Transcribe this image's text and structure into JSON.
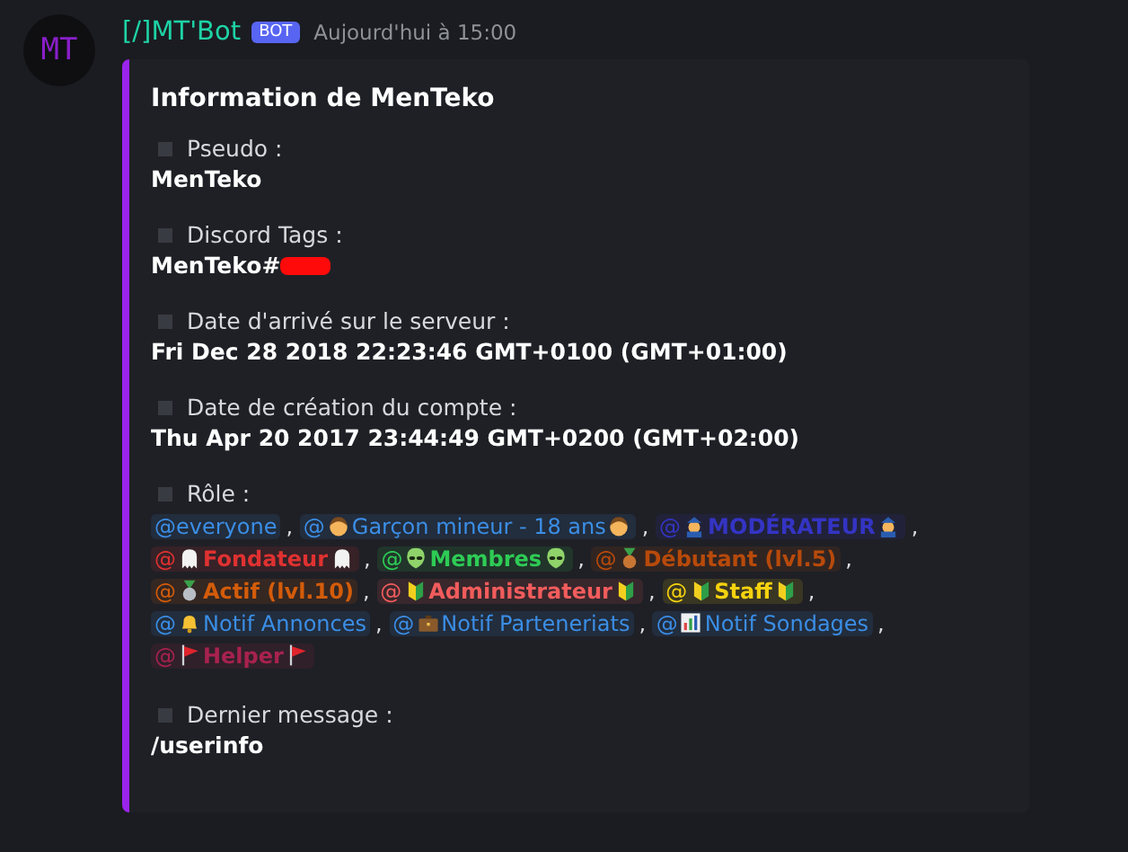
{
  "message": {
    "avatar_text": "MT",
    "author": "[/]MT'Bot",
    "badge": "BOT",
    "timestamp": "Aujourd'hui à 15:00"
  },
  "embed": {
    "title": "Information de MenTeko",
    "fields": [
      {
        "kind": "text",
        "name": "Pseudo :",
        "value": "MenTeko"
      },
      {
        "kind": "redacted",
        "name": "Discord Tags :",
        "value": "MenTeko#"
      },
      {
        "kind": "text",
        "name": "Date d'arrivé sur le serveur :",
        "value": "Fri Dec 28 2018 22:23:46 GMT+0100 (GMT+01:00)"
      },
      {
        "kind": "text",
        "name": "Date de création du compte :",
        "value": "Thu Apr 20 2017 23:44:49 GMT+0200 (GMT+02:00)"
      },
      {
        "kind": "roles",
        "name": "Rôle :",
        "separator": ",",
        "roles": [
          {
            "prefix": "@",
            "name": "everyone",
            "color": "#3b8ee6",
            "bold": false,
            "kind": "none"
          },
          {
            "prefix": "@",
            "name": "Garçon mineur - 18 ans",
            "color": "#3b8ee6",
            "bold": false,
            "kind": "boy",
            "icon_after": true
          },
          {
            "prefix": "@",
            "name": "MODÉRATEUR",
            "color": "#3434c4",
            "bold": true,
            "kind": "officer",
            "icon_after": true
          },
          {
            "prefix": "@",
            "name": "Fondateur",
            "color": "#e03131",
            "bold": true,
            "kind": "ghost",
            "icon_after": true
          },
          {
            "prefix": "@",
            "name": "Membres",
            "color": "#2ecc55",
            "bold": true,
            "kind": "alien",
            "icon_after": true
          },
          {
            "prefix": "@",
            "name": "Débutant (lvl.5)",
            "color": "#b84a0a",
            "bold": true,
            "kind": "bronze"
          },
          {
            "prefix": "@",
            "name": "Actif (lvl.10)",
            "color": "#d35c0a",
            "bold": true,
            "kind": "silver"
          },
          {
            "prefix": "@",
            "name": "Administrateur",
            "color": "#f25c5c",
            "bold": true,
            "kind": "beginner",
            "icon_after": true
          },
          {
            "prefix": "@",
            "name": "Staff",
            "color": "#f5d20f",
            "bold": true,
            "kind": "beginner",
            "icon_after": true
          },
          {
            "prefix": "@",
            "name": "Notif Annonces",
            "color": "#3b8ee6",
            "bold": false,
            "kind": "bell"
          },
          {
            "prefix": "@",
            "name": "Notif Parteneriats",
            "color": "#3b8ee6",
            "bold": false,
            "kind": "briefcase"
          },
          {
            "prefix": "@",
            "name": "Notif Sondages",
            "color": "#3b8ee6",
            "bold": false,
            "kind": "chart"
          },
          {
            "prefix": "@",
            "name": "Helper",
            "color": "#a8224e",
            "bold": true,
            "kind": "flag",
            "icon_after": true
          }
        ]
      },
      {
        "kind": "text",
        "name": "Dernier message :",
        "value": "/userinfo"
      }
    ]
  }
}
